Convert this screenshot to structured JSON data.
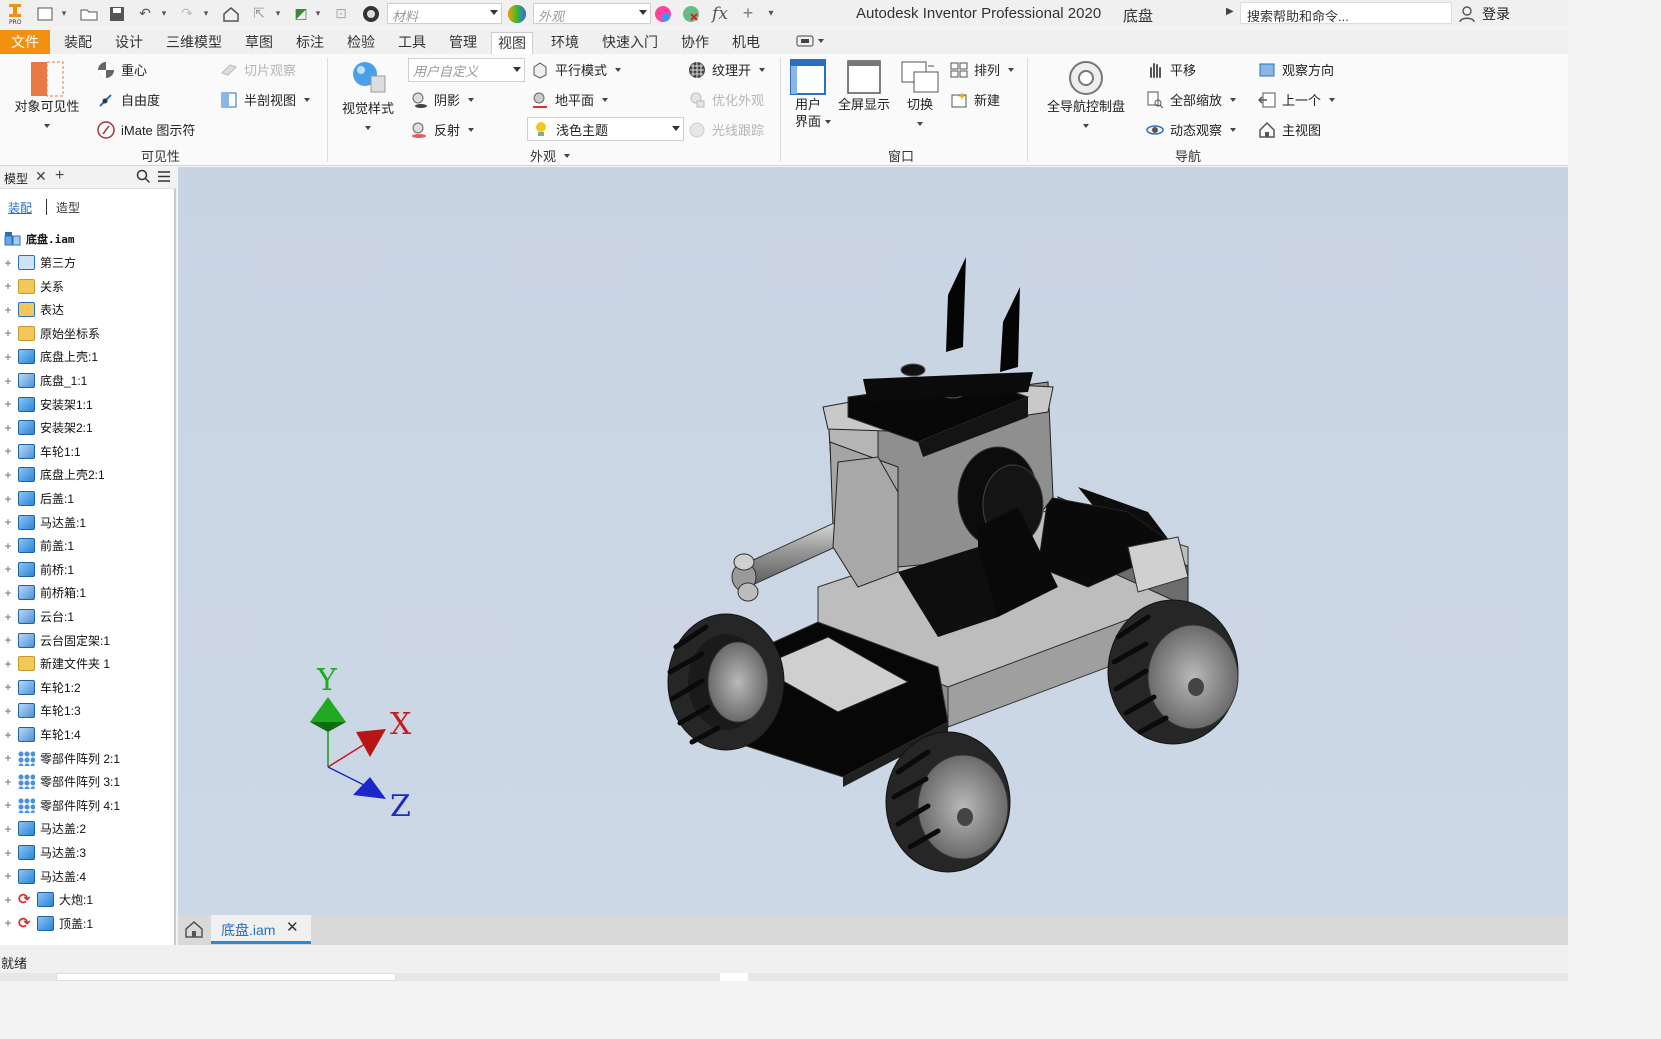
{
  "titlebar": {
    "title": "Autodesk Inventor Professional 2020",
    "document": "底盘",
    "material_placeholder": "材料",
    "appearance_placeholder": "外观",
    "search_placeholder": "搜索帮助和命令...",
    "login": "登录"
  },
  "menu": {
    "file": "文件",
    "tabs": [
      "装配",
      "设计",
      "三维模型",
      "草图",
      "标注",
      "检验",
      "工具",
      "管理",
      "视图",
      "环境",
      "快速入门",
      "协作",
      "机电"
    ],
    "active": "视图"
  },
  "ribbon": {
    "visibility": {
      "object_visibility": "对象可见性",
      "center_of_gravity": "重心",
      "dof": "自由度",
      "imate_glyph": "iMate 图示符",
      "slice_graphics": "切片观察",
      "half_section": "半剖视图",
      "group": "可见性"
    },
    "appearance": {
      "visual_style": "视觉样式",
      "custom": "用户自定义",
      "parallel": "平行模式",
      "shadows": "阴影",
      "reflections": "反射",
      "ground_plane": "地平面",
      "light_theme": "浅色主题",
      "texture_on": "纹理开",
      "optimize": "优化外观",
      "ray_tracing": "光线跟踪",
      "group": "外观"
    },
    "window": {
      "user_interface_1": "用户",
      "user_interface_2": "界面",
      "full_screen": "全屏显示",
      "switch": "切换",
      "arrange": "排列",
      "new": "新建",
      "group": "窗口"
    },
    "navigate": {
      "full_nav_wheel": "全导航控制盘",
      "pan": "平移",
      "zoom_all": "全部缩放",
      "orbit": "动态观察",
      "view_face": "观察方向",
      "previous": "上一个",
      "home_view": "主视图",
      "group": "导航"
    }
  },
  "browser": {
    "title": "模型",
    "tab_assembly": "装配",
    "tab_modeling": "造型",
    "root": "底盘.iam",
    "items": [
      {
        "label": "第三方",
        "icon": "third-party-icon"
      },
      {
        "label": "关系",
        "icon": "folder-icon"
      },
      {
        "label": "表达",
        "icon": "representations-icon"
      },
      {
        "label": "原始坐标系",
        "icon": "folder-icon"
      },
      {
        "label": "底盘上壳:1",
        "icon": "part-icon"
      },
      {
        "label": "底盘_1:1",
        "icon": "subassembly-icon"
      },
      {
        "label": "安装架1:1",
        "icon": "part-icon"
      },
      {
        "label": "安装架2:1",
        "icon": "part-icon"
      },
      {
        "label": "车轮1:1",
        "icon": "subassembly-icon"
      },
      {
        "label": "底盘上壳2:1",
        "icon": "part-icon"
      },
      {
        "label": "后盖:1",
        "icon": "part-icon"
      },
      {
        "label": "马达盖:1",
        "icon": "part-icon"
      },
      {
        "label": "前盖:1",
        "icon": "part-icon"
      },
      {
        "label": "前桥:1",
        "icon": "part-icon"
      },
      {
        "label": "前桥箱:1",
        "icon": "subassembly-icon"
      },
      {
        "label": "云台:1",
        "icon": "subassembly-icon"
      },
      {
        "label": "云台固定架:1",
        "icon": "subassembly-icon"
      },
      {
        "label": "新建文件夹 1",
        "icon": "folder-icon"
      },
      {
        "label": "车轮1:2",
        "icon": "subassembly-icon"
      },
      {
        "label": "车轮1:3",
        "icon": "subassembly-icon"
      },
      {
        "label": "车轮1:4",
        "icon": "subassembly-icon"
      },
      {
        "label": "零部件阵列 2:1",
        "icon": "pattern-icon"
      },
      {
        "label": "零部件阵列 3:1",
        "icon": "pattern-icon"
      },
      {
        "label": "零部件阵列 4:1",
        "icon": "pattern-icon"
      },
      {
        "label": "马达盖:2",
        "icon": "part-icon"
      },
      {
        "label": "马达盖:3",
        "icon": "part-icon"
      },
      {
        "label": "马达盖:4",
        "icon": "part-icon"
      },
      {
        "label": "大炮:1",
        "icon": "update-part-icon"
      },
      {
        "label": "顶盖:1",
        "icon": "update-part-icon"
      }
    ]
  },
  "viewport": {
    "axis_x": "X",
    "axis_y": "Y",
    "axis_z": "Z"
  },
  "doctabs": {
    "active": "底盘.iam"
  },
  "status": {
    "text": "就绪"
  }
}
